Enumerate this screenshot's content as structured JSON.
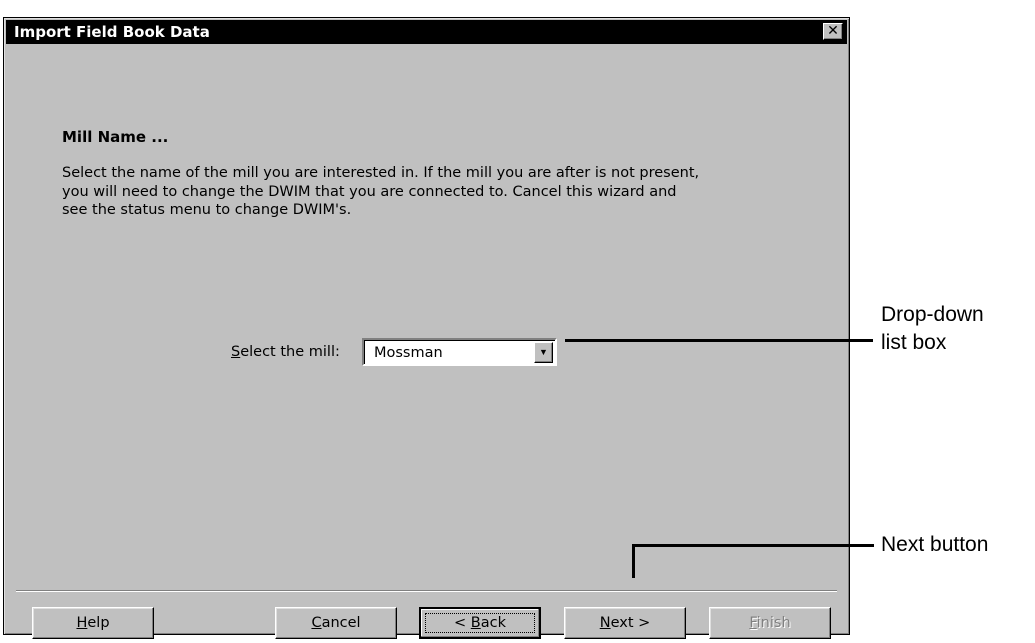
{
  "window": {
    "title": "Import Field Book Data",
    "close_glyph": "✕"
  },
  "page": {
    "heading": "Mill Name ...",
    "description_lines": [
      "Select the name of the mill you are interested in. If the mill you are after is not present,",
      "you will need to change the DWIM that you are connected to.  Cancel this wizard and",
      "see the status menu to change DWIM's."
    ]
  },
  "mill_select": {
    "label_mnemonic": "S",
    "label_rest": "elect the mill:",
    "value": "Mossman",
    "arrow_glyph": "▼"
  },
  "buttons": {
    "help": {
      "mnemonic": "H",
      "rest": "elp"
    },
    "cancel": {
      "mnemonic": "C",
      "rest": "ancel"
    },
    "back": {
      "prefix": "< ",
      "mnemonic": "B",
      "rest": "ack"
    },
    "next": {
      "mnemonic": "N",
      "rest": "ext >"
    },
    "finish": {
      "mnemonic": "F",
      "rest": "inish"
    }
  },
  "annotations": {
    "dropdown_line1": "Drop-down",
    "dropdown_line2": "list box",
    "next_button": "Next button"
  }
}
